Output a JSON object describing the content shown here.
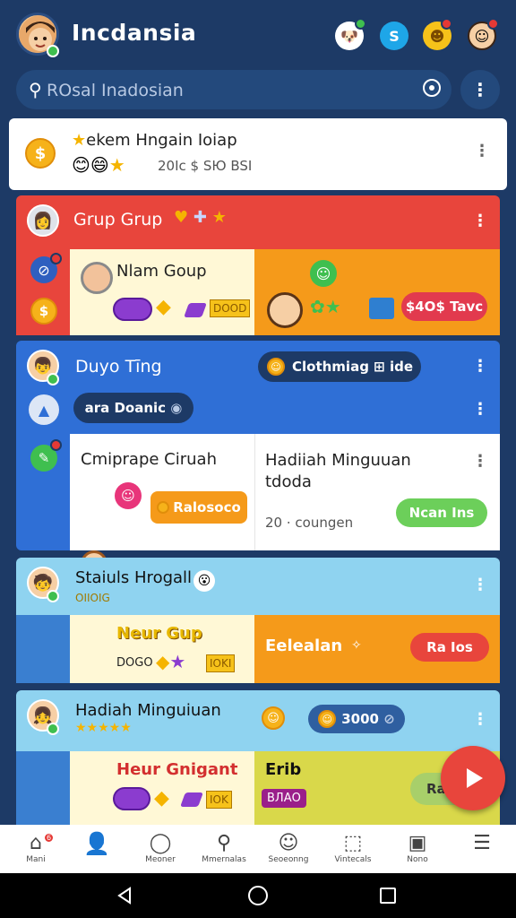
{
  "header": {
    "title": "Incdansia",
    "icons": [
      "dog-icon",
      "skype-icon",
      "emoji-badge-icon",
      "profile-alert-icon"
    ]
  },
  "search": {
    "text": "ROsal Inadosian"
  },
  "top_card": {
    "title": "ekem Hngain Ioiap",
    "count": "20Iс $ SЮ BSI"
  },
  "red_card": {
    "title": "Grup Grup",
    "left_title": "Nlam Goup",
    "left_value": "DOOD",
    "right_pill": "$4О$ Tavc"
  },
  "blue_card": {
    "title": "Duyo Tīng",
    "header_pill": "Clothmiag ⊞ ide",
    "sub_pill": "ara Doanic",
    "left_title": "Cmiprape Ciruah",
    "left_pill": "Ralosoco",
    "right_title": "Hadiiah Minguuan tdoda",
    "right_meta": "20 ⋅ cоungen",
    "right_pill": "Ncan Ins"
  },
  "teal_card": {
    "title": "Staiuls Hrogall",
    "subtitle": "OIIOIG",
    "left_title": "Neur Gup",
    "left_value": "DOGO",
    "right_title": "Eelealan",
    "right_pill": "Ra Ios"
  },
  "bottom_card": {
    "title": "Hadiah Minguiuan",
    "pill": "3000",
    "left_title": "Heur Gnigant",
    "left_value": "ВЛАО",
    "right_title": "Erib",
    "right_pill": "Ra"
  },
  "nav": [
    {
      "label": "Mani",
      "icon": "home-icon",
      "badge": "6"
    },
    {
      "label": "",
      "icon": "profile-icon",
      "badge": ""
    },
    {
      "label": "Meoner",
      "icon": "chat-icon",
      "badge": ""
    },
    {
      "label": "Mmernalas",
      "icon": "search-icon",
      "badge": ""
    },
    {
      "label": "Seoeonng",
      "icon": "smile-icon",
      "badge": ""
    },
    {
      "label": "Vintecals",
      "icon": "box-icon",
      "badge": ""
    },
    {
      "label": "Nono",
      "icon": "news-icon",
      "badge": ""
    },
    {
      "label": "",
      "icon": "menu-icon",
      "badge": ""
    }
  ]
}
